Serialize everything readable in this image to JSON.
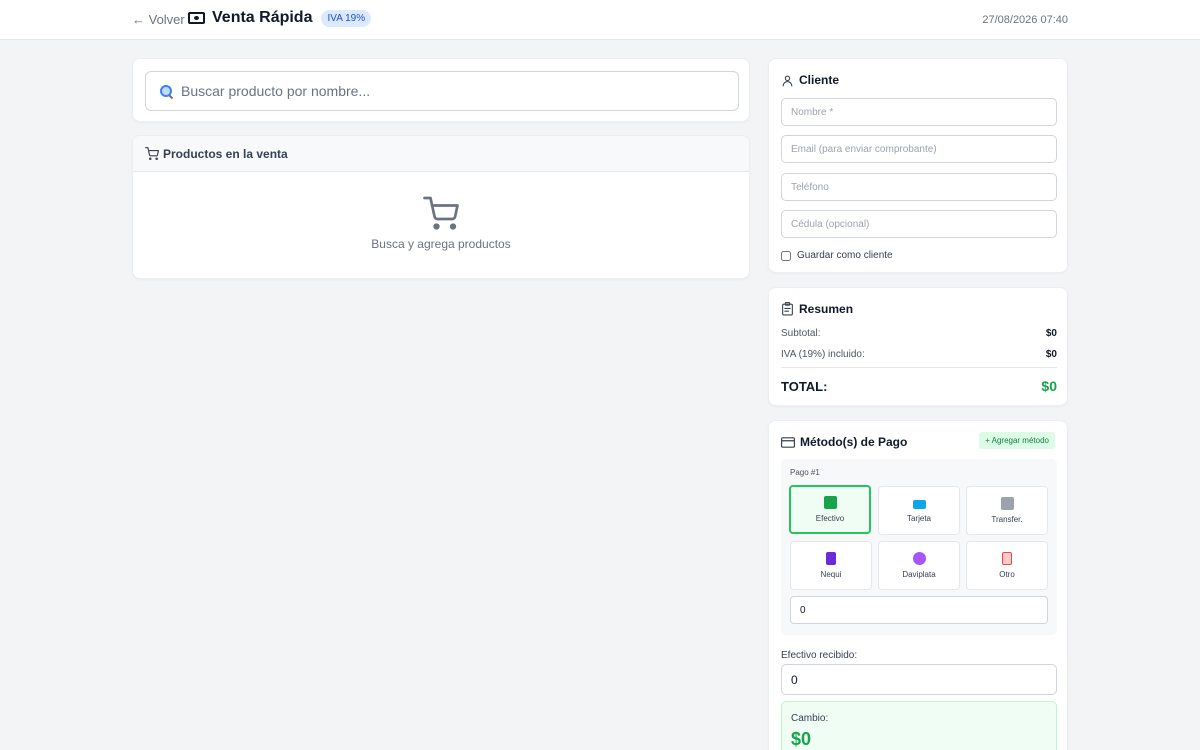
{
  "header": {
    "back_label": "← Volver",
    "title": "Venta Rápida",
    "badge": "IVA 19%",
    "datetime": "27/08/2026 07:40"
  },
  "search": {
    "placeholder": "Buscar producto por nombre..."
  },
  "products": {
    "title": "Productos en la venta",
    "empty_text": "Busca y agrega productos"
  },
  "client": {
    "title": "Cliente",
    "name_placeholder": "Nombre *",
    "email_placeholder": "Email (para enviar comprobante)",
    "phone_placeholder": "Teléfono",
    "id_placeholder": "Cédula (opcional)",
    "save_label": "Guardar como cliente"
  },
  "summary": {
    "title": "Resumen",
    "subtotal_label": "Subtotal:",
    "subtotal_value": "$0",
    "iva_label": "IVA (19%) incluido:",
    "iva_value": "$0",
    "total_label": "TOTAL:",
    "total_value": "$0"
  },
  "payment": {
    "title": "Método(s) de Pago",
    "add_label": "+ Agregar método",
    "pago_label": "Pago #1",
    "methods": [
      {
        "label": "Efectivo",
        "icon": "cash-icon",
        "color": "#16a34a"
      },
      {
        "label": "Tarjeta",
        "icon": "card-icon",
        "color": "#0ea5e9"
      },
      {
        "label": "Transfer.",
        "icon": "bank-icon",
        "color": "#6b7280"
      },
      {
        "label": "Nequi",
        "icon": "phone-icon",
        "color": "#7c3aed"
      },
      {
        "label": "Daviplata",
        "icon": "heart-icon",
        "color": "#a855f7"
      },
      {
        "label": "Otro",
        "icon": "clipboard-icon",
        "color": "#ef4444"
      }
    ],
    "amount_value": "0",
    "cash_received_label": "Efectivo recibido:",
    "cash_received_value": "0",
    "change_label": "Cambio:",
    "change_value": "$0"
  }
}
